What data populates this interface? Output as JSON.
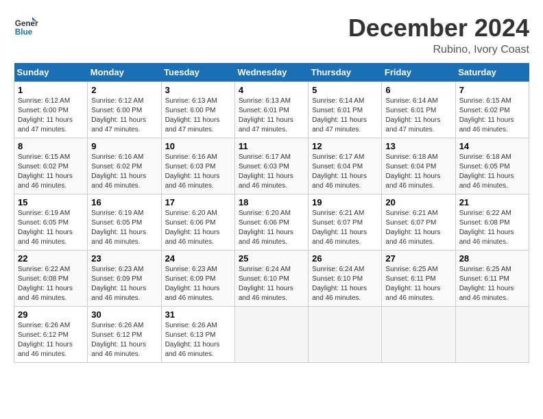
{
  "header": {
    "logo_text_general": "General",
    "logo_text_blue": "Blue",
    "month": "December 2024",
    "location": "Rubino, Ivory Coast"
  },
  "weekdays": [
    "Sunday",
    "Monday",
    "Tuesday",
    "Wednesday",
    "Thursday",
    "Friday",
    "Saturday"
  ],
  "weeks": [
    [
      {
        "day": "1",
        "sunrise": "6:12 AM",
        "sunset": "6:00 PM",
        "daylight": "11 hours and 47 minutes."
      },
      {
        "day": "2",
        "sunrise": "6:12 AM",
        "sunset": "6:00 PM",
        "daylight": "11 hours and 47 minutes."
      },
      {
        "day": "3",
        "sunrise": "6:13 AM",
        "sunset": "6:00 PM",
        "daylight": "11 hours and 47 minutes."
      },
      {
        "day": "4",
        "sunrise": "6:13 AM",
        "sunset": "6:01 PM",
        "daylight": "11 hours and 47 minutes."
      },
      {
        "day": "5",
        "sunrise": "6:14 AM",
        "sunset": "6:01 PM",
        "daylight": "11 hours and 47 minutes."
      },
      {
        "day": "6",
        "sunrise": "6:14 AM",
        "sunset": "6:01 PM",
        "daylight": "11 hours and 47 minutes."
      },
      {
        "day": "7",
        "sunrise": "6:15 AM",
        "sunset": "6:02 PM",
        "daylight": "11 hours and 46 minutes."
      }
    ],
    [
      {
        "day": "8",
        "sunrise": "6:15 AM",
        "sunset": "6:02 PM",
        "daylight": "11 hours and 46 minutes."
      },
      {
        "day": "9",
        "sunrise": "6:16 AM",
        "sunset": "6:02 PM",
        "daylight": "11 hours and 46 minutes."
      },
      {
        "day": "10",
        "sunrise": "6:16 AM",
        "sunset": "6:03 PM",
        "daylight": "11 hours and 46 minutes."
      },
      {
        "day": "11",
        "sunrise": "6:17 AM",
        "sunset": "6:03 PM",
        "daylight": "11 hours and 46 minutes."
      },
      {
        "day": "12",
        "sunrise": "6:17 AM",
        "sunset": "6:04 PM",
        "daylight": "11 hours and 46 minutes."
      },
      {
        "day": "13",
        "sunrise": "6:18 AM",
        "sunset": "6:04 PM",
        "daylight": "11 hours and 46 minutes."
      },
      {
        "day": "14",
        "sunrise": "6:18 AM",
        "sunset": "6:05 PM",
        "daylight": "11 hours and 46 minutes."
      }
    ],
    [
      {
        "day": "15",
        "sunrise": "6:19 AM",
        "sunset": "6:05 PM",
        "daylight": "11 hours and 46 minutes."
      },
      {
        "day": "16",
        "sunrise": "6:19 AM",
        "sunset": "6:05 PM",
        "daylight": "11 hours and 46 minutes."
      },
      {
        "day": "17",
        "sunrise": "6:20 AM",
        "sunset": "6:06 PM",
        "daylight": "11 hours and 46 minutes."
      },
      {
        "day": "18",
        "sunrise": "6:20 AM",
        "sunset": "6:06 PM",
        "daylight": "11 hours and 46 minutes."
      },
      {
        "day": "19",
        "sunrise": "6:21 AM",
        "sunset": "6:07 PM",
        "daylight": "11 hours and 46 minutes."
      },
      {
        "day": "20",
        "sunrise": "6:21 AM",
        "sunset": "6:07 PM",
        "daylight": "11 hours and 46 minutes."
      },
      {
        "day": "21",
        "sunrise": "6:22 AM",
        "sunset": "6:08 PM",
        "daylight": "11 hours and 46 minutes."
      }
    ],
    [
      {
        "day": "22",
        "sunrise": "6:22 AM",
        "sunset": "6:08 PM",
        "daylight": "11 hours and 46 minutes."
      },
      {
        "day": "23",
        "sunrise": "6:23 AM",
        "sunset": "6:09 PM",
        "daylight": "11 hours and 46 minutes."
      },
      {
        "day": "24",
        "sunrise": "6:23 AM",
        "sunset": "6:09 PM",
        "daylight": "11 hours and 46 minutes."
      },
      {
        "day": "25",
        "sunrise": "6:24 AM",
        "sunset": "6:10 PM",
        "daylight": "11 hours and 46 minutes."
      },
      {
        "day": "26",
        "sunrise": "6:24 AM",
        "sunset": "6:10 PM",
        "daylight": "11 hours and 46 minutes."
      },
      {
        "day": "27",
        "sunrise": "6:25 AM",
        "sunset": "6:11 PM",
        "daylight": "11 hours and 46 minutes."
      },
      {
        "day": "28",
        "sunrise": "6:25 AM",
        "sunset": "6:11 PM",
        "daylight": "11 hours and 46 minutes."
      }
    ],
    [
      {
        "day": "29",
        "sunrise": "6:26 AM",
        "sunset": "6:12 PM",
        "daylight": "11 hours and 46 minutes."
      },
      {
        "day": "30",
        "sunrise": "6:26 AM",
        "sunset": "6:12 PM",
        "daylight": "11 hours and 46 minutes."
      },
      {
        "day": "31",
        "sunrise": "6:26 AM",
        "sunset": "6:13 PM",
        "daylight": "11 hours and 46 minutes."
      },
      null,
      null,
      null,
      null
    ]
  ]
}
